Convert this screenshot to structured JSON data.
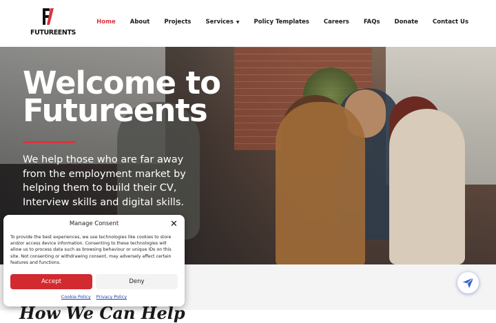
{
  "header": {
    "logo_text": "FUTUREENTS",
    "nav": [
      {
        "label": "Home",
        "active": true
      },
      {
        "label": "About"
      },
      {
        "label": "Projects"
      },
      {
        "label": "Services",
        "dropdown": true
      },
      {
        "label": "Policy Templates"
      },
      {
        "label": "Careers"
      },
      {
        "label": "FAQs"
      },
      {
        "label": "Donate"
      },
      {
        "label": "Contact Us"
      }
    ],
    "caret": "▼"
  },
  "hero": {
    "title_line1": "Welcome to",
    "title_line2": "Futureents",
    "text": "We help those who are far away from the employment market by helping them to build their CV, Interview skills and digital skills."
  },
  "section": {
    "title": "How We Can Help"
  },
  "consent": {
    "title": "Manage Consent",
    "close": "✕",
    "body": "To provide the best experiences, we use technologies like cookies to store and/or access device information. Consenting to these technologies will allow us to process data such as browsing behaviour or unique IDs on this site. Not consenting or withdrawing consent, may adversely affect certain features and functions.",
    "accept_label": "Accept",
    "deny_label": "Deny",
    "cookie_policy": "Cookie Policy",
    "privacy_policy": "Privacy Policy"
  },
  "colors": {
    "accent": "#d9363e",
    "accept_button": "#d12a2f",
    "link": "#1e3ea8"
  },
  "icons": {
    "fab": "paper-plane-icon",
    "close": "close-icon",
    "caret": "chevron-down-icon"
  }
}
